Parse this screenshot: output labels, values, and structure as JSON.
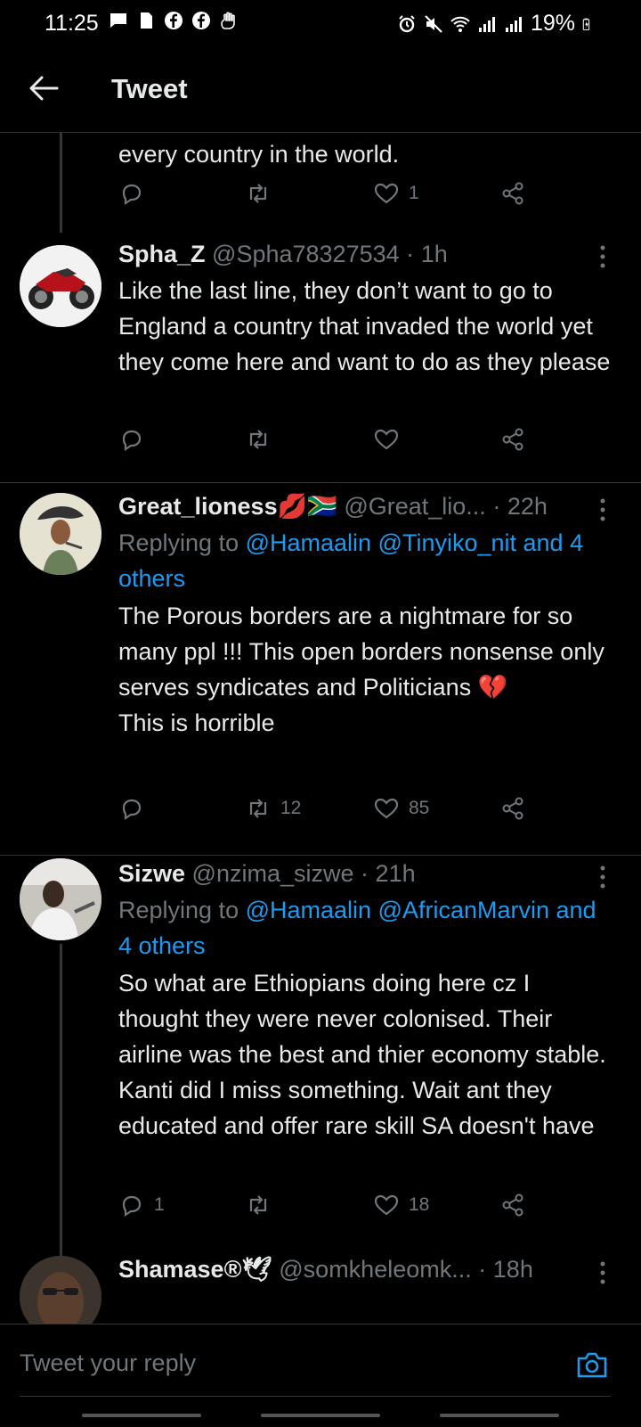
{
  "status_bar": {
    "time": "11:25",
    "battery": "19%",
    "left_icons": [
      "message-icon",
      "sd-card-icon",
      "facebook-icon",
      "facebook-icon",
      "hand-icon"
    ],
    "right_icons": [
      "alarm-icon",
      "mute-icon",
      "wifi-icon",
      "signal-icon",
      "signal-icon"
    ]
  },
  "header": {
    "title": "Tweet"
  },
  "partial_tweet": {
    "text": "every country in the world.",
    "likes": "1"
  },
  "tweets": [
    {
      "name": "Spha_Z",
      "handle": "@Spha78327534",
      "time": "1h",
      "text": "Like the last line, they don’t want to go to England a country that invaded the world yet they come here and want to do as they please",
      "replies": "",
      "retweets": "",
      "likes": ""
    },
    {
      "name": "Great_lioness💋🇿🇦",
      "handle": "@Great_lio...",
      "time": "22h",
      "replying_prefix": "Replying to ",
      "replying_links": "@Hamaalin @Tinyiko_nit and 4 others",
      "text": "The Porous borders are a nightmare for so many ppl !!! This open borders nonsense only serves syndicates and Politicians 💔\nThis is horrible",
      "replies": "",
      "retweets": "12",
      "likes": "85"
    },
    {
      "name": "Sizwe",
      "handle": "@nzima_sizwe",
      "time": "21h",
      "replying_prefix": "Replying to ",
      "replying_links": "@Hamaalin @AfricanMarvin and 4 others",
      "text": "So what are Ethiopians doing here cz I thought they were never colonised. Their airline was the best and thier economy stable. Kanti did I miss something. Wait ant they educated and offer rare skill SA doesn't have",
      "replies": "1",
      "retweets": "",
      "likes": "18"
    },
    {
      "name": "Shamase®🕊",
      "handle": "@somkheleomk...",
      "time": "18h"
    }
  ],
  "composer": {
    "placeholder": "Tweet your reply"
  },
  "colors": {
    "background": "#000000",
    "text": "#e7e9ea",
    "secondary": "#71767b",
    "accent": "#1d9bf0",
    "divider": "#2f3336"
  }
}
